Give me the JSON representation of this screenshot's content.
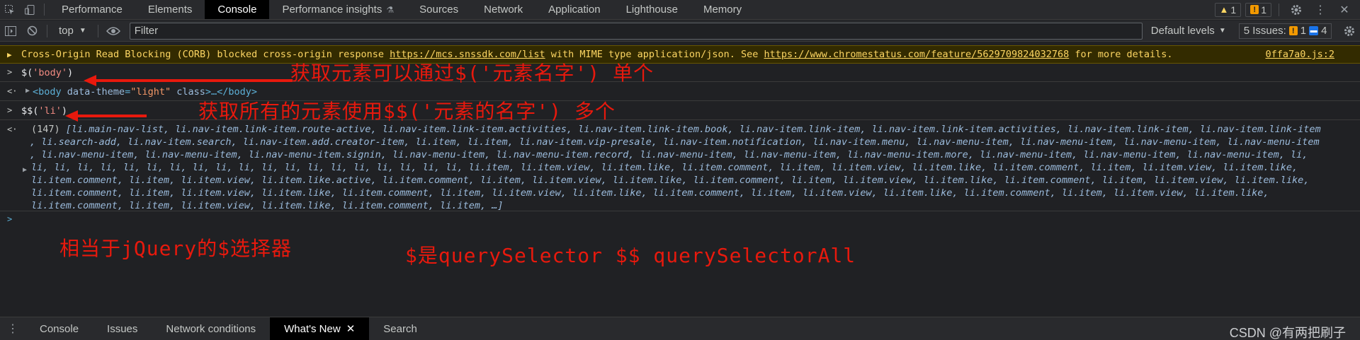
{
  "tabs": [
    "Performance",
    "Elements",
    "Console",
    "Performance insights",
    "Sources",
    "Network",
    "Application",
    "Lighthouse",
    "Memory"
  ],
  "active_tab": "Console",
  "top_badges": {
    "warn_count": "1",
    "issue_count": "1"
  },
  "toolbar": {
    "context": "top",
    "filter_placeholder": "Filter",
    "levels": "Default levels",
    "issues_label": "5 Issues:",
    "issues_warn": "1",
    "issues_info": "4"
  },
  "warning": {
    "text_a": "Cross-Origin Read Blocking (CORB) blocked cross-origin response ",
    "url_a": "https://mcs.snssdk.com/list",
    "text_b": " with MIME type application/json. See ",
    "url_b": "https://www.chromestatus.com/feature/5629709824032768",
    "text_c": " for more details.",
    "source": "0ffa7a0.js:2"
  },
  "entries": {
    "cmd1_prefix": "$(",
    "cmd1_arg": "'body'",
    "cmd1_suffix": ")",
    "res1_open": "<body ",
    "res1_attr": "data-theme",
    "res1_eq": "=",
    "res1_val": "\"light\"",
    "res1_attr2": " class",
    "res1_close": ">…</body>",
    "cmd2_prefix": "$$(",
    "cmd2_arg": "'li'",
    "cmd2_suffix": ")",
    "res2_count": "(147)",
    "res2_lines": [
      "[li.main-nav-list, li.nav-item.link-item.route-active, li.nav-item.link-item.activities, li.nav-item.link-item.book, li.nav-item.link-item, li.nav-item.link-item.activities, li.nav-item.link-item, li.nav-item.link-item",
      ", li.search-add, li.nav-item.search, li.nav-item.add.creator-item, li.item, li.item, li.nav-item.vip-presale, li.nav-item.notification, li.nav-item.menu, li.nav-menu-item, li.nav-menu-item, li.nav-menu-item, li.nav-menu-item",
      ", li.nav-menu-item, li.nav-menu-item, li.nav-menu-item.signin, li.nav-menu-item, li.nav-menu-item.record, li.nav-menu-item, li.nav-menu-item, li.nav-menu-item.more, li.nav-menu-item, li.nav-menu-item, li.nav-menu-item, li,",
      "li, li, li, li, li, li, li, li, li, li, li, li, li, li, li, li, li, li, li, li.item, li.item.view, li.item.like, li.item.comment, li.item, li.item.view, li.item.like, li.item.comment, li.item, li.item.view, li.item.like,",
      "li.item.comment, li.item, li.item.view, li.item.like.active, li.item.comment, li.item, li.item.view, li.item.like, li.item.comment, li.item, li.item.view, li.item.like, li.item.comment, li.item, li.item.view, li.item.like,",
      "li.item.comment, li.item, li.item.view, li.item.like, li.item.comment, li.item, li.item.view, li.item.like, li.item.comment, li.item, li.item.view, li.item.like, li.item.comment, li.item, li.item.view, li.item.like,",
      "li.item.comment, li.item, li.item.view, li.item.like, li.item.comment, li.item, …]"
    ]
  },
  "annotations": {
    "a1": "获取元素可以通过$('元素名字')  单个",
    "a2": "获取所有的元素使用$$('元素的名字')  多个",
    "a3": "相当于jQuery的$选择器",
    "a4": "$是querySelector $$ querySelectorAll"
  },
  "drawer_tabs": [
    "Console",
    "Issues",
    "Network conditions",
    "What's New",
    "Search"
  ],
  "drawer_active": "What's New",
  "watermark": "CSDN @有两把刷子",
  "colors": {
    "annotation": "#e8190d",
    "warning_bg": "#332b00",
    "warning_text": "#fdd663"
  }
}
